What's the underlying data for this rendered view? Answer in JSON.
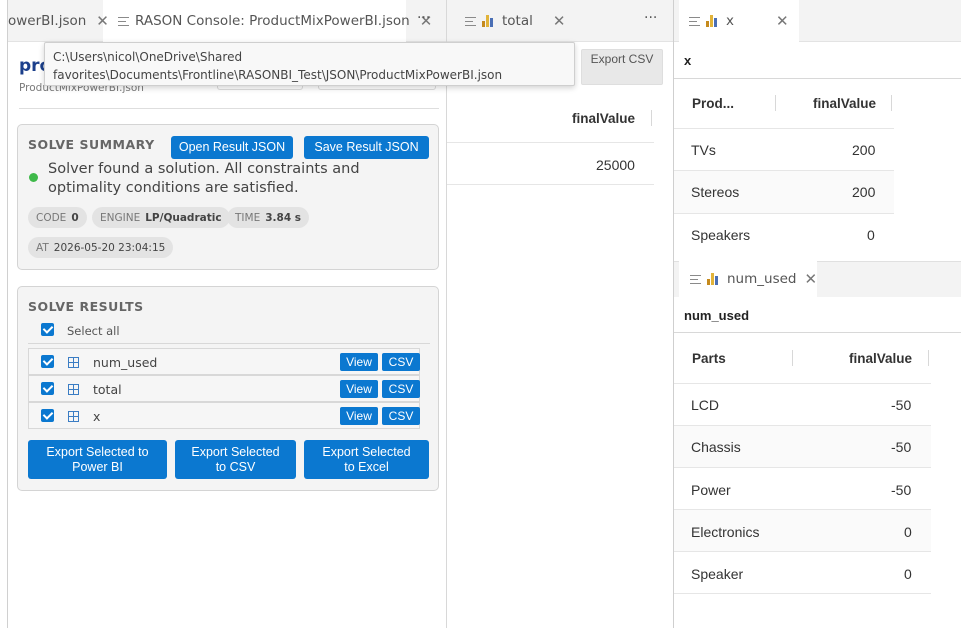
{
  "left": {
    "tabs": [
      {
        "label": "owerBI.json"
      },
      {
        "label": "RASON Console: ProductMixPowerBI.json"
      }
    ],
    "more": "···",
    "tooltip": {
      "line1": "C:\\Users\\nicol\\OneDrive\\Shared",
      "line2": "favorites\\Documents\\Frontline\\RASONBI_Test\\JSON\\ProductMixPowerBI.json"
    },
    "title": "pro",
    "subtitle": "ProductMixPowerBI.json",
    "summary": {
      "heading": "SOLVE SUMMARY",
      "open_label": "Open Result JSON",
      "save_label": "Save Result JSON",
      "message": "Solver found a solution. All constraints and optimality conditions are satisfied.",
      "status_color": "#3fb94a",
      "code_label": "CODE",
      "code_value": "0",
      "engine_label": "ENGINE",
      "engine_value": "LP/Quadratic",
      "time_label": "TIME",
      "time_value": "3.84 s",
      "at_label": "AT",
      "at_value": "2026-05-20 23:04:15"
    },
    "results": {
      "heading": "SOLVE RESULTS",
      "select_all": "Select all",
      "view_label": "View",
      "csv_label": "CSV",
      "rows": [
        {
          "name": "num_used"
        },
        {
          "name": "total"
        },
        {
          "name": "x"
        }
      ],
      "export_powerbi": "Export Selected to Power BI",
      "export_csv": "Export Selected to CSV",
      "export_excel": "Export Selected to Excel"
    }
  },
  "middle": {
    "tab_label": "total",
    "more": "···",
    "export_csv": "Export CSV",
    "header": "finalValue",
    "value": "25000"
  },
  "x_panel": {
    "tab_label": "x",
    "table_label": "x",
    "headers": [
      "Prod...",
      "finalValue"
    ],
    "rows": [
      {
        "name": "TVs",
        "value": "200"
      },
      {
        "name": "Stereos",
        "value": "200"
      },
      {
        "name": "Speakers",
        "value": "0"
      }
    ]
  },
  "num_panel": {
    "tab_label": "num_used",
    "table_label": "num_used",
    "headers": [
      "Parts",
      "finalValue"
    ],
    "rows": [
      {
        "name": "LCD",
        "value": "-50"
      },
      {
        "name": "Chassis",
        "value": "-50"
      },
      {
        "name": "Power",
        "value": "-50"
      },
      {
        "name": "Electronics",
        "value": "0"
      },
      {
        "name": "Speaker",
        "value": "0"
      }
    ]
  },
  "colors": {
    "accent": "#0b78d0",
    "title": "#1b3f8b"
  }
}
